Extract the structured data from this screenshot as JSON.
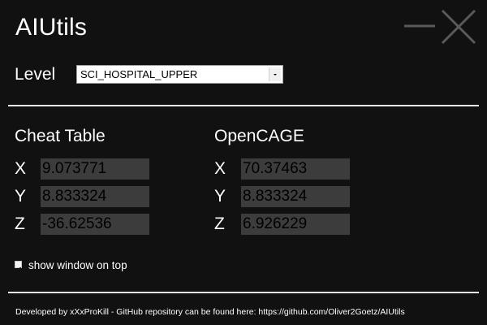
{
  "app": {
    "title": "AIUtils"
  },
  "window_controls": {
    "minimize_icon": "minimize-icon",
    "close_icon": "close-icon",
    "icon_color": "#5a5a5a"
  },
  "level": {
    "label": "Level",
    "selected": "SCI_HOSPITAL_UPPER"
  },
  "cheat_table": {
    "title": "Cheat Table",
    "x_label": "X",
    "y_label": "Y",
    "z_label": "Z",
    "x_value": "9.073771",
    "y_value": "8.833324",
    "z_value": "-36.62536"
  },
  "opencage": {
    "title": "OpenCAGE",
    "x_label": "X",
    "y_label": "Y",
    "z_label": "Z",
    "x_value": "70.37463",
    "y_value": "8.833324",
    "z_value": "6.926229"
  },
  "options": {
    "show_on_top_label": "show window on top",
    "show_on_top_checked": true
  },
  "footer": {
    "text": "Developed by xXxProKill - GitHub repository can be found here: https://github.com/Oliver2Goetz/AIUtils"
  },
  "colors": {
    "background": "#111111",
    "field_background": "#3c3c3c",
    "text": "#ffffff",
    "divider": "#e8e8e8"
  }
}
